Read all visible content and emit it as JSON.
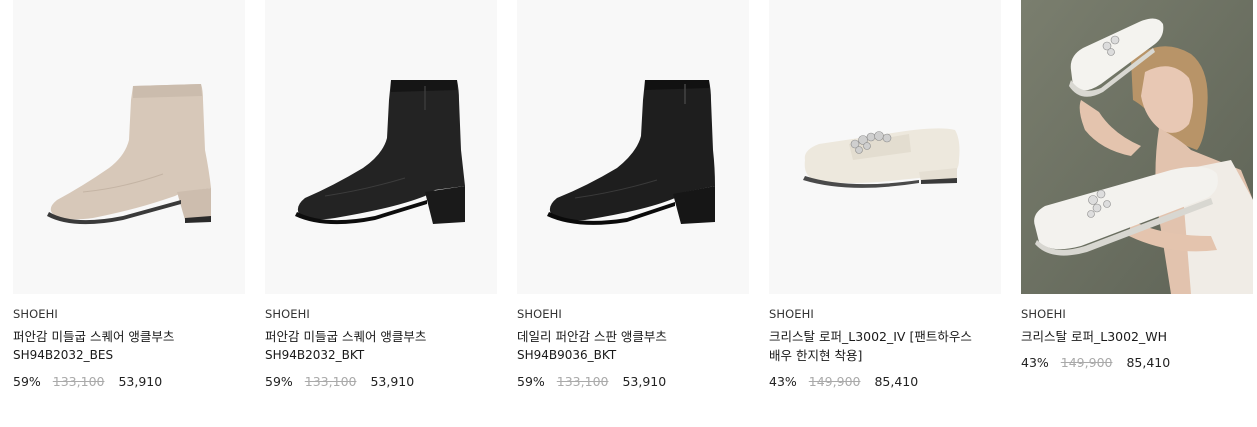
{
  "products": [
    {
      "brand": "SHOEHI",
      "name": "퍼안감 미들굽 스퀘어 앵클부츠",
      "code": "SH94B2032_BES",
      "discount": "59%",
      "original_price": "133,100",
      "sale_price": "53,910",
      "image": "beige-suede-ankle-boot",
      "color": "#d8cabb"
    },
    {
      "brand": "SHOEHI",
      "name": "퍼안감 미들굽 스퀘어 앵클부츠",
      "code": "SH94B2032_BKT",
      "discount": "59%",
      "original_price": "133,100",
      "sale_price": "53,910",
      "image": "black-leather-ankle-boot",
      "color": "#1f1f1f"
    },
    {
      "brand": "SHOEHI",
      "name": "데일리 퍼안감 스판 앵클부츠",
      "code": "SH94B9036_BKT",
      "discount": "59%",
      "original_price": "133,100",
      "sale_price": "53,910",
      "image": "black-stretch-ankle-boot",
      "color": "#1b1b1b"
    },
    {
      "brand": "SHOEHI",
      "name": "크리스탈 로퍼_L3002_IV [팬트하우스 배우 한지현 착용]",
      "code": "",
      "discount": "43%",
      "original_price": "149,900",
      "sale_price": "85,410",
      "image": "ivory-crystal-loafer",
      "color": "#ece7dc"
    },
    {
      "brand": "SHOEHI",
      "name": "크리스탈 로퍼_L3002_WH",
      "code": "",
      "discount": "43%",
      "original_price": "149,900",
      "sale_price": "85,410",
      "image": "model-holding-white-loafers",
      "color": "#f2f2f0"
    }
  ]
}
